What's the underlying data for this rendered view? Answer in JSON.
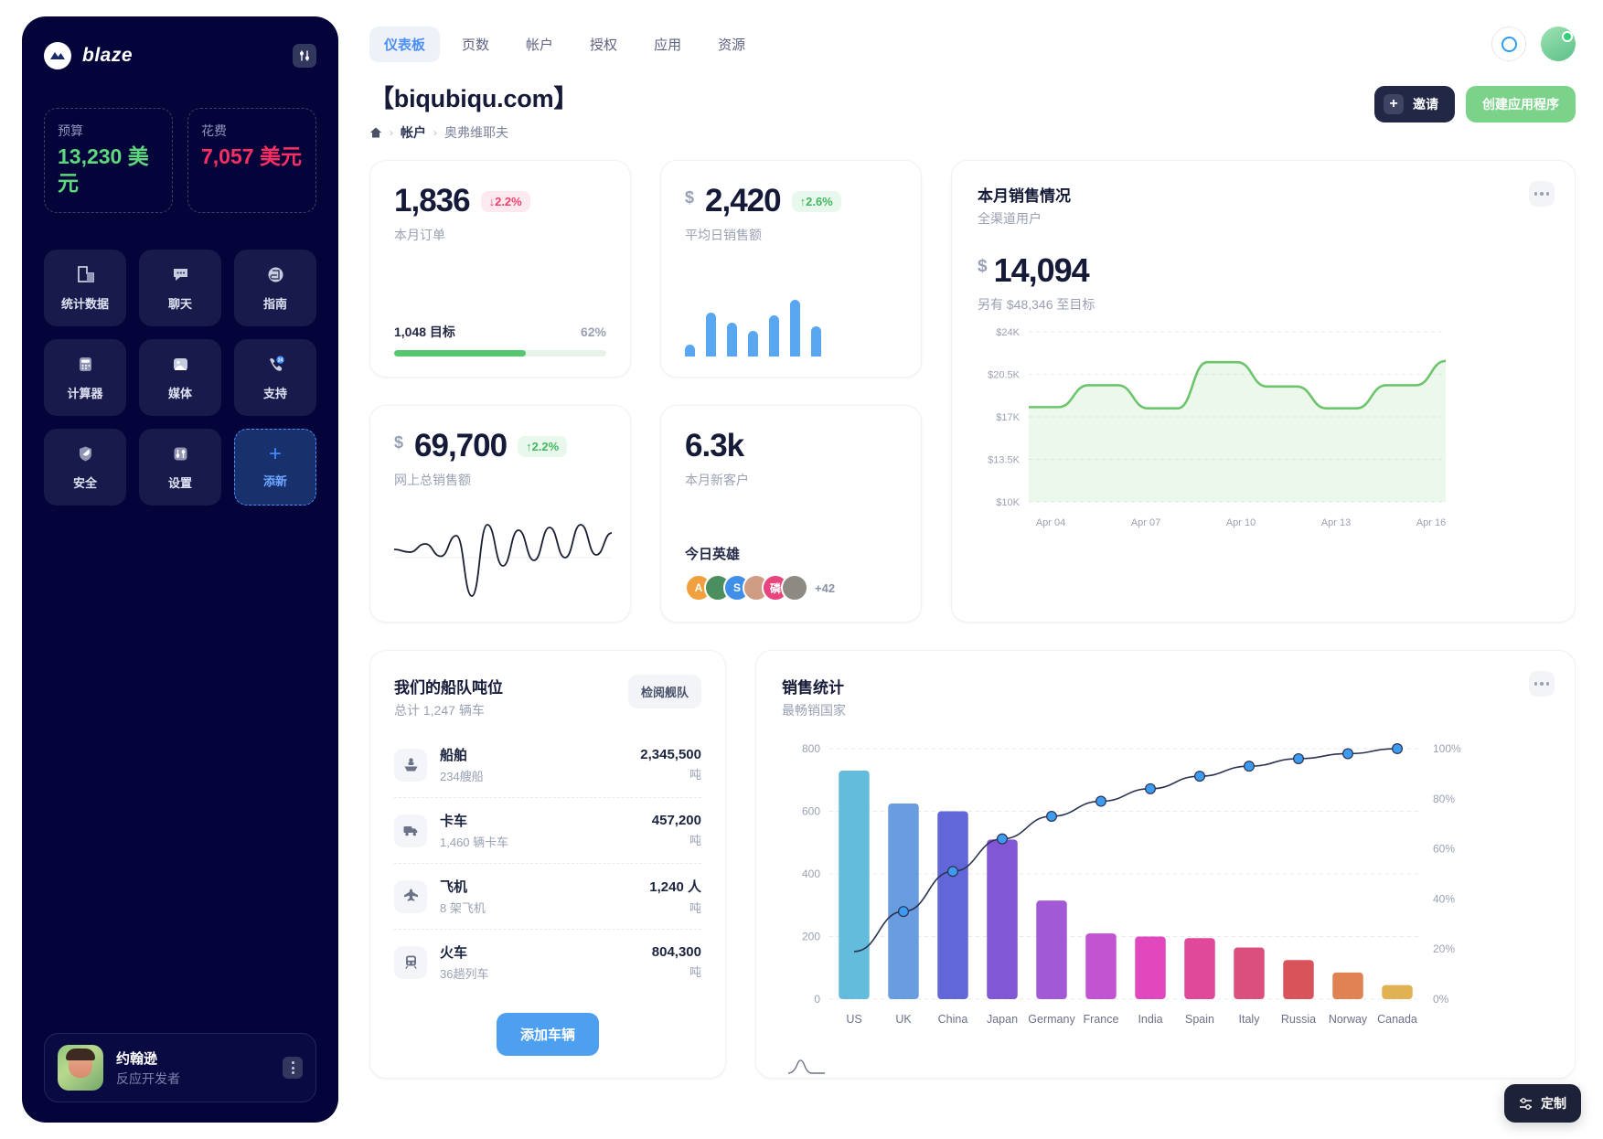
{
  "sidebar": {
    "brand": "blaze",
    "brand_icon": "blaze-logo-icon",
    "tool_icon": "sliders-icon",
    "stats": [
      {
        "label": "预算",
        "value": "13,230 美元",
        "color": "#5ed87c"
      },
      {
        "label": "花费",
        "value": "7,057 美元",
        "color": "#fb2f63"
      }
    ],
    "tiles": [
      {
        "label": "统计数据",
        "icon": "chart-icon"
      },
      {
        "label": "聊天",
        "icon": "chat-icon"
      },
      {
        "label": "指南",
        "icon": "guide-icon"
      },
      {
        "label": "计算器",
        "icon": "calculator-icon"
      },
      {
        "label": "媒体",
        "icon": "media-icon"
      },
      {
        "label": "支持",
        "icon": "support-24-icon"
      },
      {
        "label": "安全",
        "icon": "shield-icon"
      },
      {
        "label": "设置",
        "icon": "settings-sliders-icon"
      },
      {
        "label": "添新",
        "icon": "plus-icon"
      }
    ],
    "profile": {
      "name": "约翰逊",
      "role": "反应开发者",
      "menu_icon": "kebab-menu-icon"
    }
  },
  "topbar": {
    "tabs": [
      {
        "label": "仪表板",
        "active": true
      },
      {
        "label": "页数",
        "active": false
      },
      {
        "label": "帐户",
        "active": false
      },
      {
        "label": "授权",
        "active": false
      },
      {
        "label": "应用",
        "active": false
      },
      {
        "label": "资源",
        "active": false
      }
    ],
    "loading_icon": "circle-ring-icon",
    "avatar_icon": "user-avatar"
  },
  "header": {
    "title": "【biqubiqu.com】",
    "breadcrumb": {
      "home_icon": "home-icon",
      "items": [
        "帐户",
        "奥弗维耶夫"
      ]
    },
    "invite_label": "邀请",
    "invite_icon": "plus-icon",
    "create_label": "创建应用程序"
  },
  "kpis": {
    "orders": {
      "value": "1,836",
      "delta": "2.2%",
      "delta_dir": "down",
      "delta_arrow": "↓",
      "label": "本月订单",
      "goal_label": "1,048 目标",
      "goal_pct": "62%",
      "goal_pct_num": 62
    },
    "avg_daily": {
      "currency": "$",
      "value": "2,420",
      "delta": "2.6%",
      "delta_dir": "up",
      "delta_arrow": "↑",
      "label": "平均日销售额"
    },
    "online_total": {
      "currency": "$",
      "value": "69,700",
      "delta": "2.2%",
      "delta_dir": "up",
      "delta_arrow": "↑",
      "label": "网上总销售额"
    },
    "new_customers": {
      "value": "6.3k",
      "label": "本月新客户",
      "heroes_title": "今日英雄",
      "heroes_more": "+42",
      "heroes": [
        {
          "initial": "A",
          "color": "#f0a03c"
        },
        {
          "initial": "",
          "color": "#4c8f5e"
        },
        {
          "initial": "S",
          "color": "#3f8fe8"
        },
        {
          "initial": "",
          "color": "#cf9d84"
        },
        {
          "initial": "磷",
          "color": "#e8457f"
        },
        {
          "initial": "",
          "color": "#8d8a84"
        }
      ]
    }
  },
  "monthly_sales": {
    "title": "本月销售情况",
    "subtitle": "全渠道用户",
    "currency": "$",
    "value": "14,094",
    "note": "另有 $48,346 至目标",
    "menu_icon": "kebab-menu-icon"
  },
  "fleet": {
    "title": "我们的船队吨位",
    "subtitle": "总计 1,247 辆车",
    "review_label": "检阅舰队",
    "add_label": "添加车辆",
    "items": [
      {
        "name": "船舶",
        "sub": "234艘船",
        "value": "2,345,500",
        "unit": "吨",
        "icon": "ship-icon"
      },
      {
        "name": "卡车",
        "sub": "1,460 辆卡车",
        "value": "457,200",
        "unit": "吨",
        "icon": "truck-icon"
      },
      {
        "name": "飞机",
        "sub": "8 架飞机",
        "value": "1,240 人",
        "unit": "吨",
        "icon": "plane-icon"
      },
      {
        "name": "火车",
        "sub": "36趟列车",
        "value": "804,300",
        "unit": "吨",
        "icon": "train-icon"
      }
    ]
  },
  "sales_stats": {
    "title": "销售统计",
    "subtitle": "最畅销国家",
    "menu_icon": "kebab-menu-icon",
    "wave_icon": "wave-legend-icon"
  },
  "customize": {
    "label": "定制",
    "icon": "customize-icon"
  },
  "chart_data": [
    {
      "type": "area",
      "title": "本月销售情况",
      "subtitle": "全渠道用户",
      "xlabel": "",
      "ylabel": "",
      "ylim": [
        10000,
        24000
      ],
      "ytick_labels": [
        "$24K",
        "$20.5K",
        "$17K",
        "$13.5K",
        "$10K"
      ],
      "yticks": [
        24000,
        20500,
        17000,
        13500,
        10000
      ],
      "xtick_labels": [
        "Apr 04",
        "Apr 07",
        "Apr 10",
        "Apr 13",
        "Apr 16"
      ],
      "grid": true,
      "legend": "none",
      "line_color": "#6dc46d",
      "values": [
        17800,
        17800,
        19600,
        19600,
        17700,
        17700,
        21500,
        21500,
        19500,
        19500,
        17700,
        17700,
        19600,
        19600,
        21600
      ]
    },
    {
      "type": "bar",
      "title": "销售统计",
      "subtitle": "最畅销国家",
      "categories": [
        "US",
        "UK",
        "China",
        "Japan",
        "Germany",
        "France",
        "India",
        "Spain",
        "Italy",
        "Russia",
        "Norway",
        "Canada"
      ],
      "values": [
        730,
        625,
        600,
        510,
        315,
        210,
        200,
        195,
        165,
        125,
        85,
        45
      ],
      "bar_colors": [
        "#63bcdb",
        "#6a9ce0",
        "#6166d9",
        "#8257d6",
        "#a259d6",
        "#c254d2",
        "#e248bd",
        "#e0489a",
        "#db4f7e",
        "#d9535b",
        "#e08253",
        "#e0b253"
      ],
      "ylabel": "",
      "ylim": [
        0,
        800
      ],
      "yticks": [
        0,
        200,
        400,
        600,
        800
      ],
      "ytick_labels": [
        "0",
        "200",
        "400",
        "600",
        "800"
      ],
      "grid": true,
      "series": [
        {
          "name": "cumulative",
          "type": "line",
          "axis": "right",
          "values": [
            19,
            35,
            51,
            64,
            73,
            79,
            84,
            89,
            93,
            96,
            98,
            100
          ],
          "ylim": [
            0,
            100
          ],
          "ytick_labels": [
            "0%",
            "20%",
            "40%",
            "60%",
            "80%",
            "100%"
          ],
          "yticks": [
            0,
            20,
            40,
            60,
            80,
            100
          ],
          "line_color": "#2b3352",
          "marker_color": "#3d9bf0"
        }
      ]
    },
    {
      "type": "bar",
      "title": "平均日销售额",
      "categories": [
        "1",
        "2",
        "3",
        "4",
        "5",
        "6",
        "7"
      ],
      "values": [
        12,
        44,
        34,
        26,
        41,
        57,
        30
      ],
      "bar_color": "#58a7f0",
      "grid": false
    },
    {
      "type": "line",
      "title": "网上总销售额",
      "values": [
        52,
        50,
        56,
        47,
        62,
        18,
        70,
        40,
        66,
        44,
        68,
        46,
        70,
        48,
        64
      ],
      "line_color": "#1b1f33",
      "grid": false
    }
  ]
}
